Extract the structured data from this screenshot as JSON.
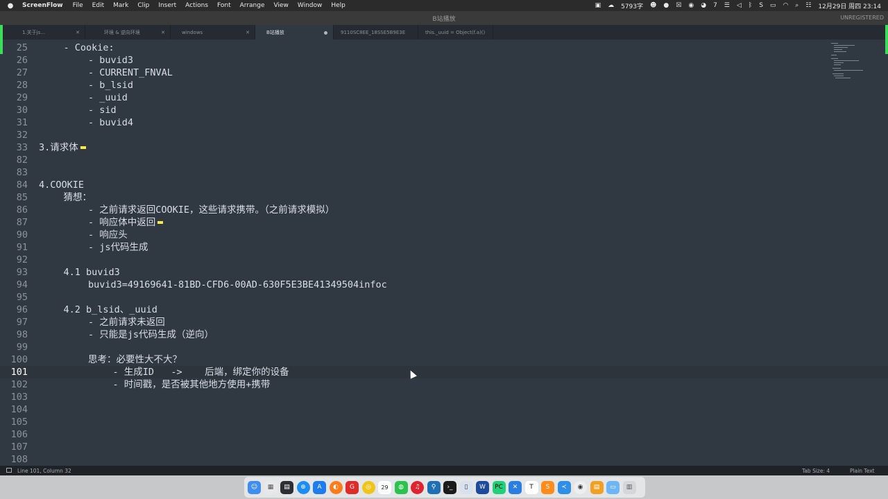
{
  "menubar": {
    "app": "ScreenFlow",
    "items": [
      "File",
      "Edit",
      "Mark",
      "Clip",
      "Insert",
      "Actions",
      "Font",
      "Arrange",
      "View",
      "Window",
      "Help"
    ],
    "word_count": "5793字",
    "battery_count": "7",
    "clock": "12月29日 周四 23:14"
  },
  "window": {
    "title": "B站播放",
    "unregistered": "UNREGISTERED"
  },
  "tabs": [
    {
      "label": "1.关于js...",
      "active": false
    },
    {
      "label": "环境 & 逆向环境",
      "active": false
    },
    {
      "label": "windows",
      "active": false
    },
    {
      "label": "B站播放",
      "active": true
    },
    {
      "label": "9110SC8EE_18SSE5B9E3E",
      "active": false
    },
    {
      "label": "this._uuid = Object(f.a)()",
      "active": false
    }
  ],
  "editor": {
    "lines": [
      {
        "n": "25",
        "indent": 1,
        "text": "- Cookie:"
      },
      {
        "n": "26",
        "indent": 2,
        "text": "- buvid3"
      },
      {
        "n": "27",
        "indent": 2,
        "text": "- CURRENT_FNVAL"
      },
      {
        "n": "28",
        "indent": 2,
        "text": "- b_lsid"
      },
      {
        "n": "29",
        "indent": 2,
        "text": "- _uuid"
      },
      {
        "n": "30",
        "indent": 2,
        "text": "- sid"
      },
      {
        "n": "31",
        "indent": 2,
        "text": "- buvid4"
      },
      {
        "n": "32",
        "indent": 0,
        "text": ""
      },
      {
        "n": "33",
        "indent": 0,
        "text": "3.请求体",
        "fold": true
      },
      {
        "n": "82",
        "indent": 0,
        "text": ""
      },
      {
        "n": "83",
        "indent": 0,
        "text": ""
      },
      {
        "n": "84",
        "indent": 0,
        "text": "4.COOKIE"
      },
      {
        "n": "85",
        "indent": 1,
        "text": "猜想："
      },
      {
        "n": "86",
        "indent": 2,
        "text": "- 之前请求返回COOKIE，这些请求携带。（之前请求模拟）"
      },
      {
        "n": "87",
        "indent": 2,
        "text": "- 响应体中返回",
        "fold": true
      },
      {
        "n": "90",
        "indent": 2,
        "text": "- 响应头"
      },
      {
        "n": "91",
        "indent": 2,
        "text": "- js代码生成"
      },
      {
        "n": "92",
        "indent": 0,
        "text": ""
      },
      {
        "n": "93",
        "indent": 1,
        "text": "4.1 buvid3"
      },
      {
        "n": "94",
        "indent": 2,
        "text": "buvid3=49169641-81BD-CFD6-00AD-630F5E3BE41349504infoc"
      },
      {
        "n": "95",
        "indent": 0,
        "text": ""
      },
      {
        "n": "96",
        "indent": 1,
        "text": "4.2 b_lsid、_uuid"
      },
      {
        "n": "97",
        "indent": 2,
        "text": "- 之前请求未返回"
      },
      {
        "n": "98",
        "indent": 2,
        "text": "- 只能是js代码生成（逆向）"
      },
      {
        "n": "99",
        "indent": 0,
        "text": ""
      },
      {
        "n": "100",
        "indent": 2,
        "text": "思考：必要性大不大？"
      },
      {
        "n": "101",
        "indent": 3,
        "text": "- 生成ID   ->    后端，绑定你的设备",
        "current": true
      },
      {
        "n": "102",
        "indent": 3,
        "text": "- 时间戳，是否被其他地方使用+携带"
      },
      {
        "n": "103",
        "indent": 0,
        "text": ""
      },
      {
        "n": "104",
        "indent": 0,
        "text": ""
      },
      {
        "n": "105",
        "indent": 0,
        "text": ""
      },
      {
        "n": "106",
        "indent": 0,
        "text": ""
      },
      {
        "n": "107",
        "indent": 0,
        "text": ""
      },
      {
        "n": "108",
        "indent": 0,
        "text": ""
      }
    ]
  },
  "statusbar": {
    "position": "Line 101, Column 32",
    "tab_size": "Tab Size: 4",
    "syntax": "Plain Text"
  },
  "dock": {
    "calendar_day": "29",
    "apps": [
      "finder-icon",
      "launchpad-icon",
      "mission-control-icon",
      "safari-icon",
      "appstore-icon",
      "firefox-icon",
      "gitee-icon",
      "chrome-icon",
      "calendar-icon",
      "wechat-icon",
      "netease-music-icon",
      "sourcetree-icon",
      "terminal-icon",
      "preview-icon",
      "wps-icon",
      "pycharm-icon",
      "xcode-icon",
      "typora-icon",
      "sublime-icon",
      "vscode-icon",
      "browser-icon",
      "notes-icon",
      "folder-icon",
      "trash-icon"
    ]
  },
  "colors": {
    "editor_bg": "#303841",
    "text": "#d8dee9",
    "fold_marker": "#f9e94a",
    "accent_green": "#3ddc5a"
  }
}
